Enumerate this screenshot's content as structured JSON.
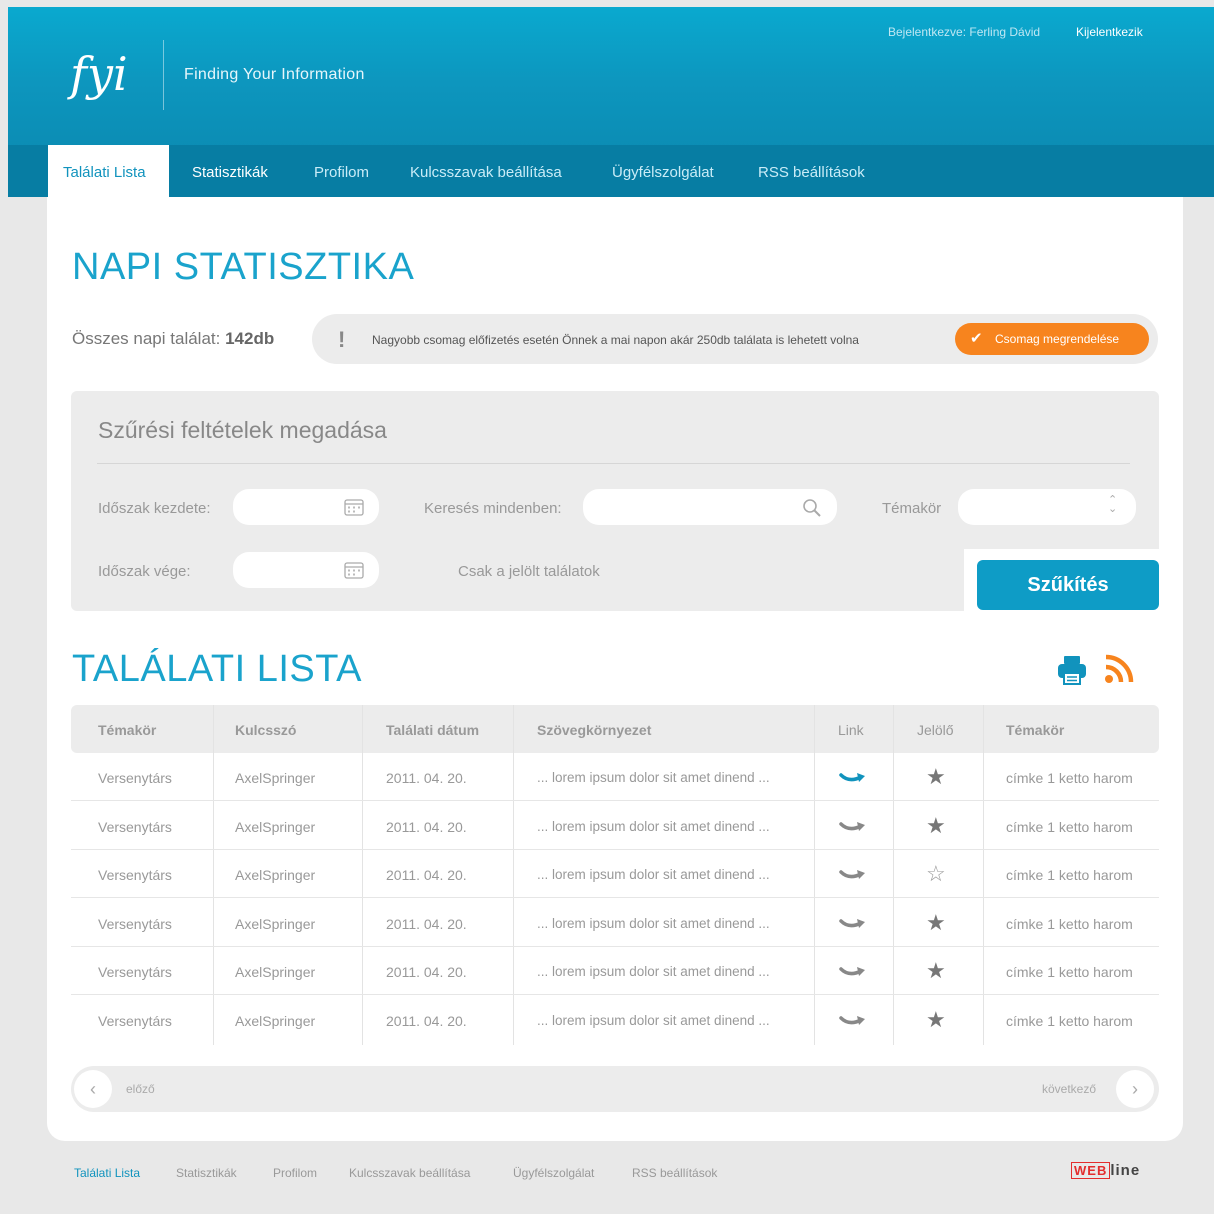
{
  "header": {
    "logo_text": "fyi",
    "tagline": "Finding Your Information",
    "login_status": "Bejelentkezve: Ferling Dávid",
    "logout": "Kijelentkezik"
  },
  "nav": {
    "tabs": [
      {
        "label": "Találati Lista"
      },
      {
        "label": "Statisztikák"
      },
      {
        "label": "Profilom"
      },
      {
        "label": "Kulcsszavak beállítása"
      },
      {
        "label": "Ügyfélszolgálat"
      },
      {
        "label": "RSS beállítások"
      }
    ]
  },
  "daily": {
    "title": "NAPI STATISZTIKA",
    "total_label": "Összes napi találat:",
    "total_value": "142db",
    "notice_icon": "!",
    "notice_text": "Nagyobb csomag előfizetés esetén Önnek a mai napon akár 250db találata is lehetett volna",
    "order_button": "Csomag megrendelése"
  },
  "filter": {
    "title": "Szűrési feltételek megadása",
    "start_label": "Időszak kezdete:",
    "end_label": "Időszak vége:",
    "search_label": "Keresés mindenben:",
    "topic_label": "Témakör",
    "only_marked_label": "Csak a jelölt találatok",
    "submit": "Szűkítés",
    "start_value": "",
    "end_value": "",
    "search_value": "",
    "topic_value": ""
  },
  "results": {
    "title": "TALÁLATI LISTA",
    "columns": [
      "Témakör",
      "Kulcsszó",
      "Találati dátum",
      "Szövegkörnyezet",
      "Link",
      "Jelölő",
      "Témakör"
    ],
    "rows": [
      {
        "topic": "Versenytárs",
        "keyword": "AxelSpringer",
        "date": "2011. 04. 20.",
        "context": "... lorem ipsum dolor sit amet dinend ...",
        "link_active": true,
        "star": "★",
        "tags": "címke 1 ketto harom"
      },
      {
        "topic": "Versenytárs",
        "keyword": "AxelSpringer",
        "date": "2011. 04. 20.",
        "context": "... lorem ipsum dolor sit amet dinend ...",
        "link_active": false,
        "star": "★",
        "tags": "címke 1 ketto harom"
      },
      {
        "topic": "Versenytárs",
        "keyword": "AxelSpringer",
        "date": "2011. 04. 20.",
        "context": "... lorem ipsum dolor sit amet dinend ...",
        "link_active": false,
        "star": "☆",
        "tags": "címke 1 ketto harom"
      },
      {
        "topic": "Versenytárs",
        "keyword": "AxelSpringer",
        "date": "2011. 04. 20.",
        "context": "... lorem ipsum dolor sit amet dinend ...",
        "link_active": false,
        "star": "★",
        "tags": "címke 1 ketto harom"
      },
      {
        "topic": "Versenytárs",
        "keyword": "AxelSpringer",
        "date": "2011. 04. 20.",
        "context": "... lorem ipsum dolor sit amet dinend ...",
        "link_active": false,
        "star": "★",
        "tags": "címke 1 ketto harom"
      },
      {
        "topic": "Versenytárs",
        "keyword": "AxelSpringer",
        "date": "2011. 04. 20.",
        "context": "... lorem ipsum dolor sit amet dinend ...",
        "link_active": false,
        "star": "★",
        "tags": "címke 1 ketto harom"
      }
    ]
  },
  "pager": {
    "prev": "előző",
    "next": "következő",
    "prev_arrow": "‹",
    "next_arrow": "›"
  },
  "footer": {
    "links": [
      {
        "label": "Találati Lista"
      },
      {
        "label": "Statisztikák"
      },
      {
        "label": "Profilom"
      },
      {
        "label": "Kulcsszavak beállítása"
      },
      {
        "label": "Ügyfélszolgálat"
      },
      {
        "label": "RSS beállítások"
      }
    ],
    "brand_mark": "WEB",
    "brand_rest": "line"
  },
  "colors": {
    "accent": "#1aa3cc",
    "header": "#0d96be",
    "nav": "#077da3",
    "order": "#f7841e",
    "rss": "#f7841e"
  },
  "icons": [
    "calendar-icon",
    "search-icon",
    "select-arrows-icon",
    "print-icon",
    "rss-icon",
    "link-icon",
    "star-icon",
    "check-icon",
    "exclamation-icon"
  ]
}
